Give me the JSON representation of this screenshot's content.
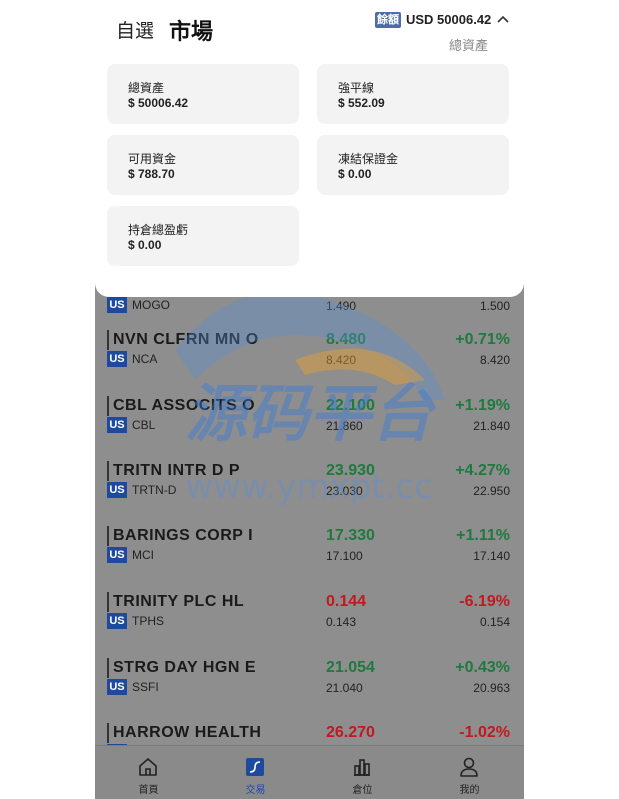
{
  "header": {
    "tab_watchlist": "自選",
    "tab_market": "市場",
    "balance_tag": "餘額",
    "balance_value": "USD 50006.42",
    "balance_sub": "總資產"
  },
  "cards": [
    {
      "label": "總資產",
      "value": "$ 50006.42"
    },
    {
      "label": "強平線",
      "value": "$ 552.09"
    },
    {
      "label": "可用資金",
      "value": "$ 788.70"
    },
    {
      "label": "凍結保證金",
      "value": "$ 0.00"
    },
    {
      "label": "持倉總盈虧",
      "value": "$ 0.00"
    }
  ],
  "stocks": [
    {
      "name": "",
      "market": "US",
      "code": "MOGO",
      "price": "",
      "prev": "1.490",
      "change": "",
      "change2": "1.500",
      "dir": "up"
    },
    {
      "name": "NVN CLFRN MN O",
      "market": "US",
      "code": "NCA",
      "price": "8.480",
      "prev": "8.420",
      "change": "+0.71%",
      "change2": "8.420",
      "dir": "up"
    },
    {
      "name": "CBL ASSOCITS O",
      "market": "US",
      "code": "CBL",
      "price": "22.100",
      "prev": "21.860",
      "change": "+1.19%",
      "change2": "21.840",
      "dir": "up"
    },
    {
      "name": "TRITN INTR D P",
      "market": "US",
      "code": "TRTN-D",
      "price": "23.930",
      "prev": "23.030",
      "change": "+4.27%",
      "change2": "22.950",
      "dir": "up"
    },
    {
      "name": "BARINGS CORP I",
      "market": "US",
      "code": "MCI",
      "price": "17.330",
      "prev": "17.100",
      "change": "+1.11%",
      "change2": "17.140",
      "dir": "up"
    },
    {
      "name": "TRINITY PLC HL",
      "market": "US",
      "code": "TPHS",
      "price": "0.144",
      "prev": "0.143",
      "change": "-6.19%",
      "change2": "0.154",
      "dir": "down"
    },
    {
      "name": "STRG DAY HGN E",
      "market": "US",
      "code": "SSFI",
      "price": "21.054",
      "prev": "21.040",
      "change": "+0.43%",
      "change2": "20.963",
      "dir": "up"
    },
    {
      "name": "HARROW HEALTH",
      "market": "US",
      "code": "",
      "price": "26.270",
      "prev": "",
      "change": "-1.02%",
      "change2": "",
      "dir": "down"
    }
  ],
  "nav": [
    {
      "label": "首頁",
      "icon": "home-icon"
    },
    {
      "label": "交易",
      "icon": "trade-icon"
    },
    {
      "label": "倉位",
      "icon": "position-icon"
    },
    {
      "label": "我的",
      "icon": "user-icon"
    }
  ],
  "watermark": {
    "text_cn": "源码平台",
    "text_url": "www.ymxpt.cc"
  },
  "colors": {
    "up": "#1e7a3e",
    "down": "#c2181f",
    "accent": "#1e4a9e"
  }
}
